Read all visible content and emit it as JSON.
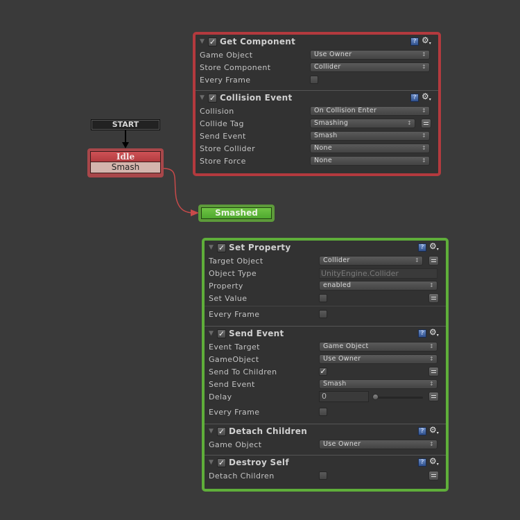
{
  "fsm": {
    "start_label": "START",
    "states": [
      {
        "name": "Idle",
        "transitions": [
          "Smash"
        ],
        "color": "#b33c40"
      },
      {
        "name": "Smashed",
        "transitions": [],
        "color": "#5fae3a"
      }
    ],
    "transition_link": {
      "from": "Idle",
      "event": "Smash",
      "to": "Smashed",
      "color": "#c84a4a"
    }
  },
  "idle_panel": {
    "border_color": "#b33a3e",
    "actions": [
      {
        "title": "Get Component",
        "enabled": true,
        "fields": [
          {
            "label": "Game Object",
            "type": "dropdown",
            "value": "Use Owner"
          },
          {
            "label": "Store Component",
            "type": "dropdown",
            "value": "Collider"
          },
          {
            "label": "Every Frame",
            "type": "checkbox",
            "checked": false
          }
        ]
      },
      {
        "title": "Collision Event",
        "enabled": true,
        "fields": [
          {
            "label": "Collision",
            "type": "dropdown",
            "value": "On Collision Enter"
          },
          {
            "label": "Collide Tag",
            "type": "dropdown",
            "value": "Smashing"
          },
          {
            "label": "Send Event",
            "type": "dropdown",
            "value": "Smash"
          },
          {
            "label": "Store Collider",
            "type": "dropdown",
            "value": "None"
          },
          {
            "label": "Store Force",
            "type": "dropdown",
            "value": "None"
          }
        ]
      }
    ]
  },
  "smashed_panel": {
    "border_color": "#5fae3a",
    "actions": [
      {
        "title": "Set Property",
        "enabled": true,
        "fields": [
          {
            "label": "Target Object",
            "type": "dropdown",
            "value": "Collider"
          },
          {
            "label": "Object Type",
            "type": "text",
            "value": "UnityEngine.Collider"
          },
          {
            "label": "Property",
            "type": "dropdown",
            "value": "enabled"
          },
          {
            "label": "Set Value",
            "type": "checkbox",
            "checked": false
          },
          {
            "label": "Every Frame",
            "type": "checkbox",
            "checked": false
          }
        ]
      },
      {
        "title": "Send Event",
        "enabled": true,
        "fields": [
          {
            "label": "Event Target",
            "type": "dropdown",
            "value": "Game Object"
          },
          {
            "label": "GameObject",
            "type": "dropdown",
            "value": "Use Owner"
          },
          {
            "label": "Send To Children",
            "type": "checkbox",
            "checked": true
          },
          {
            "label": "Send Event",
            "type": "dropdown",
            "value": "Smash"
          },
          {
            "label": "Delay",
            "type": "slider",
            "value": "0",
            "slider_fraction": 0
          },
          {
            "label": "Every Frame",
            "type": "checkbox",
            "checked": false
          }
        ]
      },
      {
        "title": "Detach Children",
        "enabled": true,
        "fields": [
          {
            "label": "Game Object",
            "type": "dropdown",
            "value": "Use Owner"
          }
        ]
      },
      {
        "title": "Destroy Self",
        "enabled": true,
        "fields": [
          {
            "label": "Detach Children",
            "type": "checkbox",
            "checked": false
          }
        ]
      }
    ]
  },
  "icons": {
    "fold": "▼",
    "check": "✓",
    "help": "?",
    "gear": "⚙",
    "gear_menu": "▾"
  }
}
